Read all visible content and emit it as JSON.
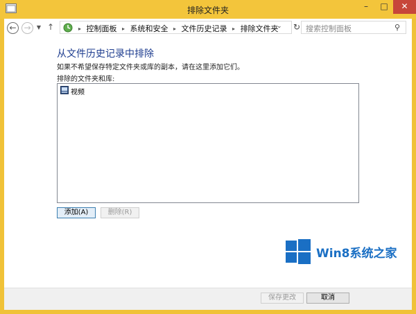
{
  "window": {
    "title": "排除文件夹",
    "controls": {
      "minimize": "–",
      "maximize": "□",
      "close": "✕"
    }
  },
  "navbar": {
    "back": "←",
    "forward": "→",
    "recent": "▼",
    "up": "↑",
    "breadcrumbs": [
      "控制面板",
      "系统和安全",
      "文件历史记录",
      "排除文件夹"
    ],
    "separator": "▸",
    "dropdown": "⌄",
    "refresh": "↻",
    "search_placeholder": "搜索控制面板",
    "search_icon": "⚲"
  },
  "main": {
    "heading": "从文件历史记录中排除",
    "description": "如果不希望保存特定文件夹或库的副本，请在这里添加它们。",
    "list_label": "排除的文件夹和库:",
    "list_items": [
      {
        "label": "视频",
        "icon": "video-library-icon"
      }
    ],
    "add_button": "添加(A)",
    "remove_button": "删除(R)"
  },
  "footer": {
    "save_button": "保存更改",
    "cancel_button": "取消"
  },
  "watermark": {
    "text": "Win8系统之家"
  },
  "colors": {
    "title_bar": "#f3c53b",
    "heading": "#1e3d8f",
    "close_button": "#c7463a",
    "watermark": "#1a6fc4"
  }
}
